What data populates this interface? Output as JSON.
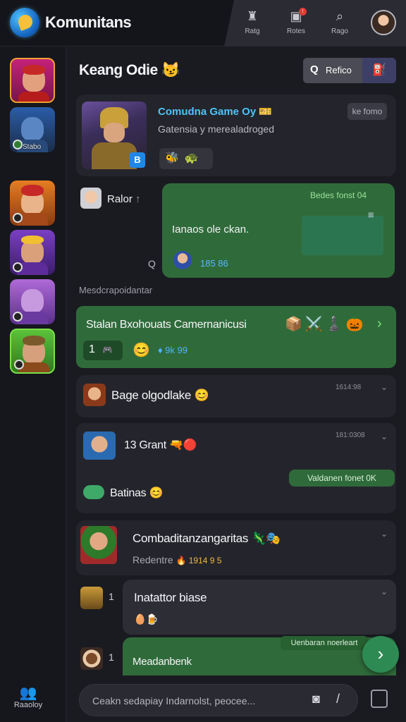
{
  "app": {
    "title": "Komunitans"
  },
  "top_nav": [
    {
      "label": "Ratg",
      "icon": "chess-rook-icon"
    },
    {
      "label": "Rotes",
      "icon": "notification-icon",
      "badge": "!"
    },
    {
      "label": "Rago",
      "icon": "search-icon"
    }
  ],
  "rail": {
    "items": [
      {
        "name": "avatar-red-warrior",
        "label": ""
      },
      {
        "name": "avatar-blue-knight",
        "label": "Stabo"
      },
      {
        "name": "avatar-red-helmet",
        "label": ""
      },
      {
        "name": "avatar-purple-elf",
        "label": ""
      },
      {
        "name": "avatar-violet-mage",
        "label": ""
      },
      {
        "name": "avatar-green-ranger",
        "label": ""
      }
    ],
    "bottom_label": "Raaoloy"
  },
  "header": {
    "title": "Keang Odie",
    "title_emoji": "😼",
    "button_label": "Refico",
    "button_icon": "Q"
  },
  "featured": {
    "title": "Comudna Game Oy",
    "title_emoji": "🎫",
    "subtitle": "Gatensia y merealadroged",
    "badge": "ke fomo",
    "chips": "🐝🐢"
  },
  "chat1": {
    "author": "Ralor",
    "bubble_top": "Bedes fonst 04",
    "bubble_text": "Ianaos ole ckan.",
    "bubble_meta": "185 86"
  },
  "section_label": "Mesdcrapoidantar",
  "highlight": {
    "title": "Stalan Bxohouats Camernanicusi",
    "icons": "📦⚔️♟️🎃",
    "count": "1",
    "count_icon": "🎮",
    "emoji": "😊",
    "meta": "♦ 9k 99"
  },
  "rows": [
    {
      "title": "Bage olgodlake",
      "emoji": "😊",
      "time": "1614:98"
    },
    {
      "title": "13 Grant",
      "prefix_emoji": "🌿",
      "suffix": "🔫🔴",
      "time": "181:0308"
    },
    {
      "title": "Batinas",
      "emoji": "😊",
      "strip": "Valdanen fonet 0K"
    },
    {
      "title": "Combaditanzangaritas",
      "suffix": "🦎🎭",
      "sub": "Redentre",
      "sub_meta": "🔥 1914 9 5"
    },
    {
      "title": "Inatattor biase",
      "count": "1",
      "sub_emoji": "🥚🍺"
    },
    {
      "title": "Meadanbenk",
      "count": "1",
      "strip": "Uenbaran noerleart"
    }
  ],
  "composer": {
    "placeholder": "Ceakn sedapiay Indarnolst, peocee..."
  }
}
